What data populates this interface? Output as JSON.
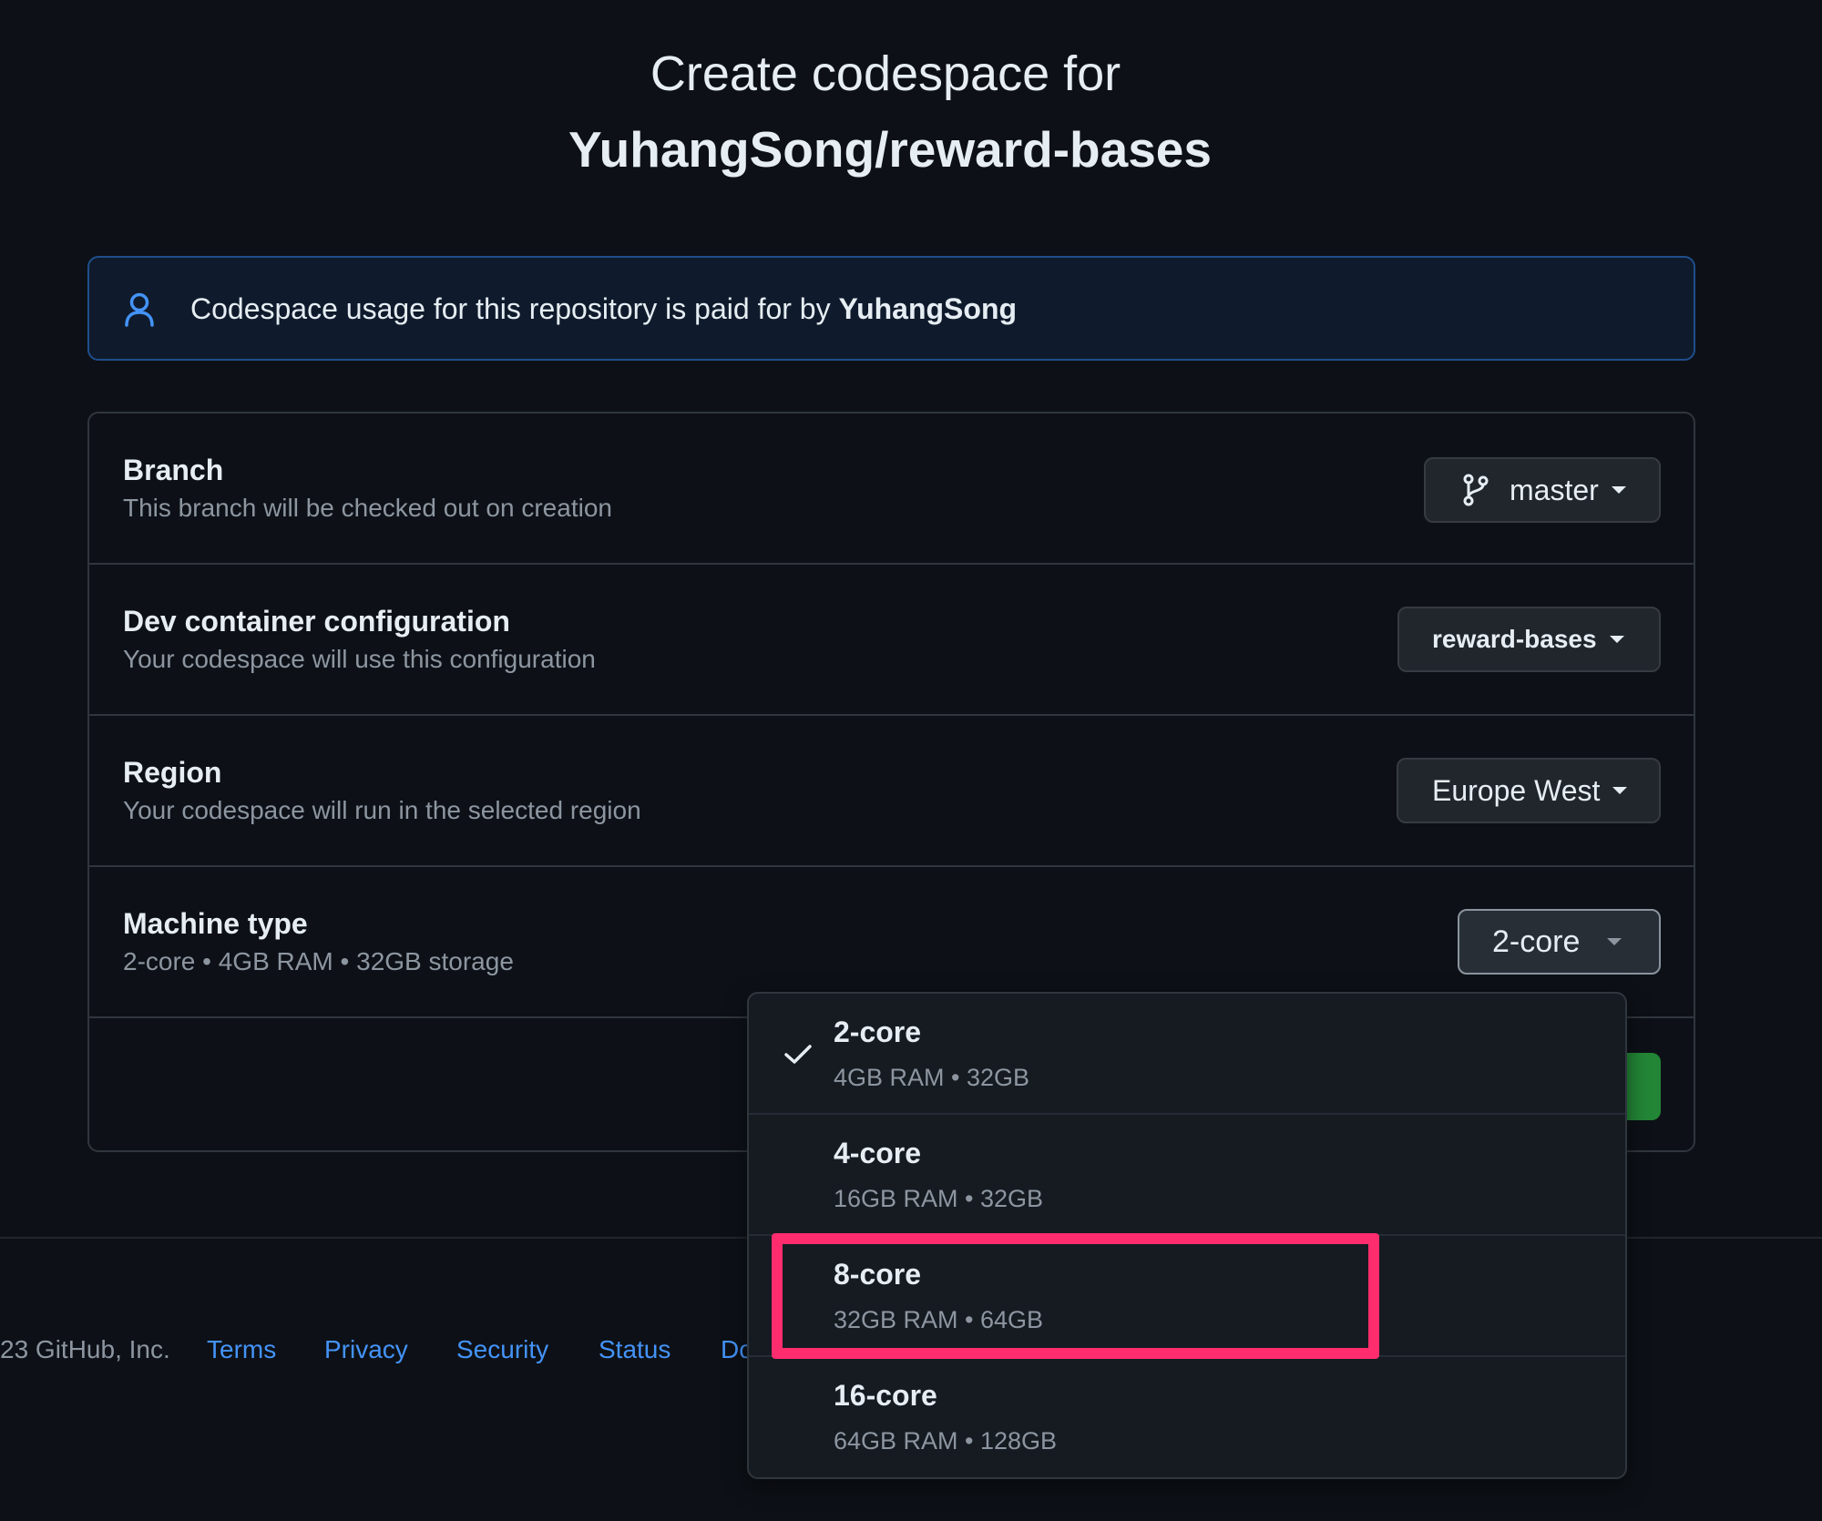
{
  "header": {
    "title_line1": "Create codespace for",
    "title_line2": "YuhangSong/reward-bases"
  },
  "notice": {
    "text": "Codespace usage for this repository is paid for by ",
    "owner": "YuhangSong",
    "icon": "person-icon"
  },
  "form": {
    "branch": {
      "label": "Branch",
      "description": "This branch will be checked out on creation",
      "value": "master",
      "icon": "git-branch-icon"
    },
    "devcontainer": {
      "label": "Dev container configuration",
      "description": "Your codespace will use this configuration",
      "value": "reward-bases"
    },
    "region": {
      "label": "Region",
      "description": "Your codespace will run in the selected region",
      "value": "Europe West"
    },
    "machine": {
      "label": "Machine type",
      "description": "2-core • 4GB RAM • 32GB storage",
      "value": "2-core"
    }
  },
  "machine_options": [
    {
      "name": "2-core",
      "spec": "4GB RAM • 32GB",
      "selected": true
    },
    {
      "name": "4-core",
      "spec": "16GB RAM • 32GB",
      "selected": false
    },
    {
      "name": "8-core",
      "spec": "32GB RAM • 64GB",
      "selected": false
    },
    {
      "name": "16-core",
      "spec": "64GB RAM • 128GB",
      "selected": false
    }
  ],
  "footer": {
    "copyright": "23 GitHub, Inc.",
    "links": [
      "Terms",
      "Privacy",
      "Security",
      "Status",
      "Do"
    ]
  },
  "colors": {
    "background": "#0d1117",
    "link": "#4493f8",
    "highlight": "#ff2d6e",
    "create_button": "#238636"
  }
}
